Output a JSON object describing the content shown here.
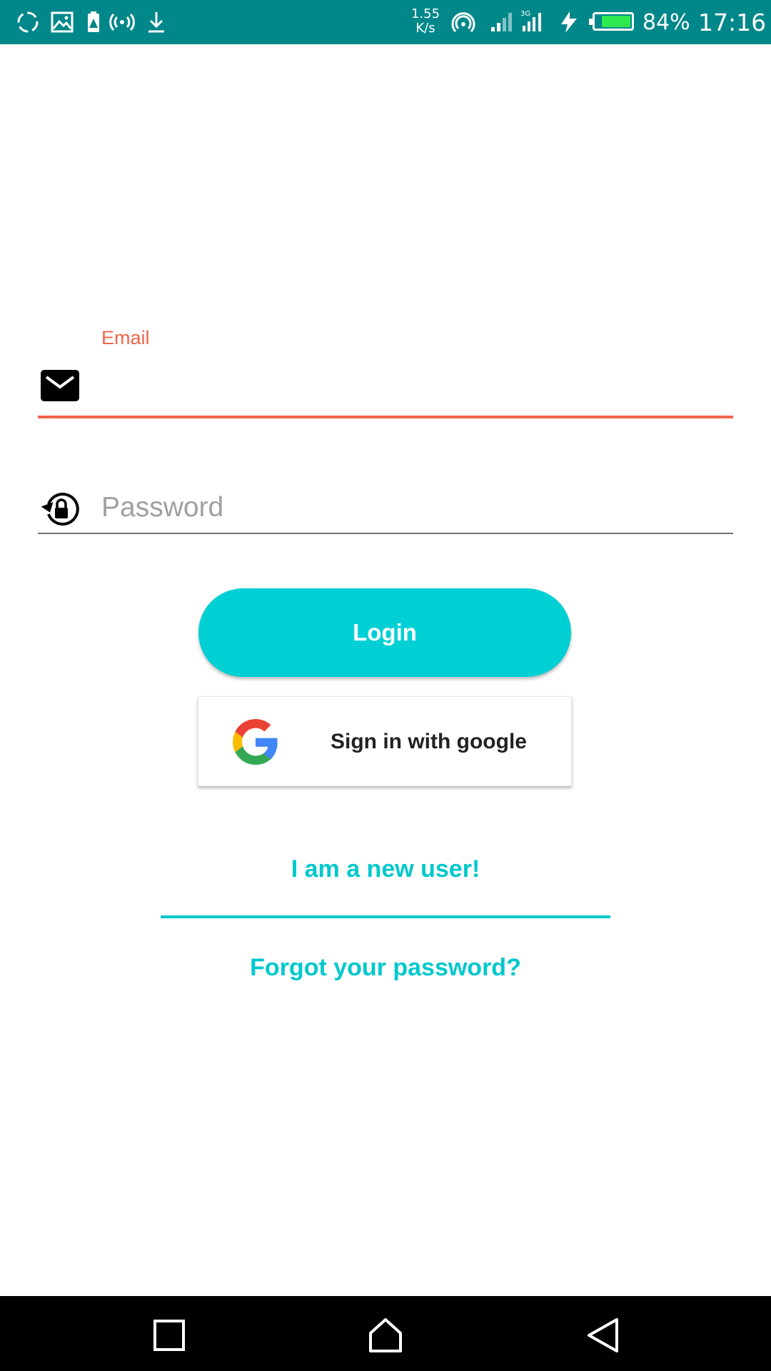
{
  "status_bar": {
    "net_speed_value": "1.55",
    "net_speed_unit": "K/s",
    "battery_percent": "84%",
    "time": "17:16",
    "network_type": "3G",
    "battery_fill_fraction": 0.84,
    "battery_color": "#2ee84f",
    "background_color": "#00878a"
  },
  "login_form": {
    "email": {
      "label": "Email",
      "value": "",
      "icon": "mail-icon",
      "accent_color": "#f0654a"
    },
    "password": {
      "placeholder": "Password",
      "value": "",
      "icon": "lock-reset-icon"
    },
    "login_button_label": "Login",
    "google_button_label": "Sign in with google",
    "new_user_link": "I am a new user!",
    "forgot_password_link": "Forgot your password?",
    "accent_color": "#00d0d4"
  },
  "nav_bar": {
    "recents": "square-icon",
    "home": "home-icon",
    "back": "back-triangle-icon"
  }
}
